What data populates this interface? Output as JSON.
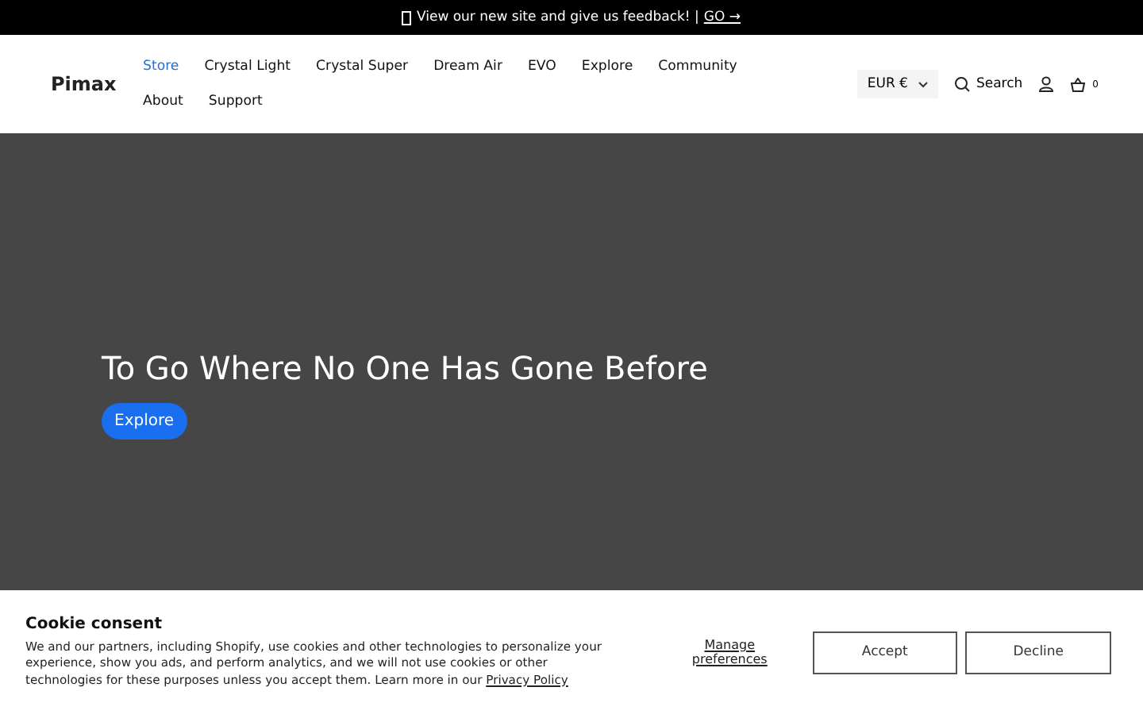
{
  "announcement": {
    "text": "View our new site and give us feedback! |",
    "link": "GO →"
  },
  "header": {
    "logo": "Pimax",
    "nav": [
      {
        "label": "Store",
        "selected": true
      },
      {
        "label": "Crystal Light",
        "selected": false
      },
      {
        "label": "Crystal Super",
        "selected": false
      },
      {
        "label": "Dream Air",
        "selected": false
      },
      {
        "label": "EVO",
        "selected": false
      },
      {
        "label": "Explore",
        "selected": false
      },
      {
        "label": "Community",
        "selected": false
      },
      {
        "label": "About",
        "selected": false
      },
      {
        "label": "Support",
        "selected": false
      }
    ],
    "currency": "EUR €",
    "search": "Search",
    "cart_count": "0"
  },
  "hero": {
    "title": "To Go Where No One Has Gone Before",
    "button": "Explore"
  },
  "cookie_banner": {
    "title": "Cookie consent",
    "text": "We and our partners, including Shopify, use cookies and other technologies to personalize your experience, show you ads, and perform analytics, and we will not use cookies or other technologies for these purposes unless you accept them. Learn more in our",
    "link": "Privacy Policy",
    "manage": "Manage preferences",
    "buttons": [
      "Accept",
      "Decline"
    ]
  }
}
